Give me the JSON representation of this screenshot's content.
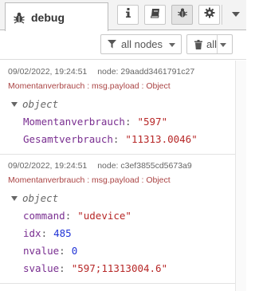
{
  "tabs": {
    "debug_label": "debug"
  },
  "toolbar": {
    "buttons": [
      {
        "name": "info",
        "icon": "info-icon"
      },
      {
        "name": "help",
        "icon": "book-icon"
      },
      {
        "name": "debug",
        "icon": "bug-icon",
        "active": true
      },
      {
        "name": "config",
        "icon": "gear-icon"
      }
    ]
  },
  "filter": {
    "nodes_label": "all nodes",
    "clear_label": "all"
  },
  "colors": {
    "topic": "#aa4444",
    "key": "#792e90",
    "string": "#b72828",
    "number": "#2033d6"
  },
  "messages": [
    {
      "timestamp": "09/02/2022, 19:24:51",
      "node": "node: 29aadd3461791c27",
      "topic": "Momentanverbrauch : msg.payload : Object",
      "type": "object",
      "props": [
        {
          "key": "Momentanverbrauch",
          "value": "\"597\""
        },
        {
          "key": "Gesamtverbrauch",
          "value": "\"11313.0046\""
        }
      ]
    },
    {
      "timestamp": "09/02/2022, 19:24:51",
      "node": "node: c3ef3855cd5673a9",
      "topic": "Momentanverbrauch : msg.payload : Object",
      "type": "object",
      "props": [
        {
          "key": "command",
          "value": "\"udevice\""
        },
        {
          "key": "idx",
          "value": "485"
        },
        {
          "key": "nvalue",
          "value": "0"
        },
        {
          "key": "svalue",
          "value": "\"597;11313004.6\""
        }
      ]
    }
  ]
}
